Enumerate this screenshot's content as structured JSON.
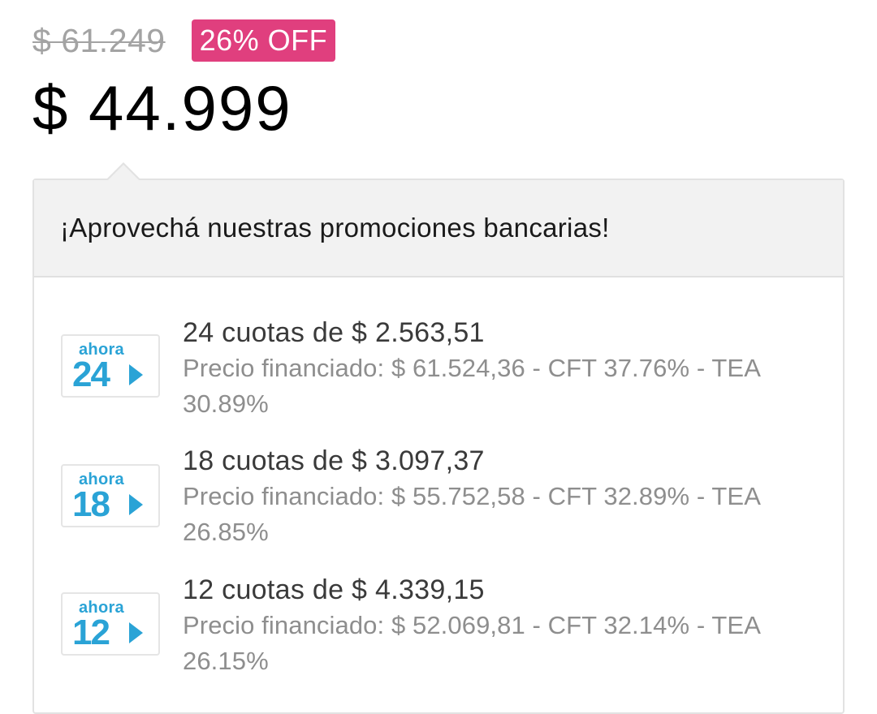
{
  "pricing": {
    "original_price": "$ 61.249",
    "discount_badge": "26% OFF",
    "current_price": "$ 44.999"
  },
  "promo": {
    "header": "¡Aprovechá nuestras promociones bancarias!",
    "plans": [
      {
        "logo_word": "ahora",
        "logo_number": "24",
        "title": "24 cuotas de $ 2.563,51",
        "detail": "Precio financiado: $ 61.524,36 - CFT 37.76% - TEA 30.89%"
      },
      {
        "logo_word": "ahora",
        "logo_number": "18",
        "title": "18 cuotas de $ 3.097,37",
        "detail": "Precio financiado: $ 55.752,58 - CFT 32.89% - TEA 26.85%"
      },
      {
        "logo_word": "ahora",
        "logo_number": "12",
        "title": "12 cuotas de $ 4.339,15",
        "detail": "Precio financiado: $ 52.069,81 - CFT 32.14% - TEA 26.15%"
      }
    ]
  },
  "colors": {
    "badge_background": "#e03f7e",
    "ahora_logo_blue": "#2aa3d6"
  }
}
